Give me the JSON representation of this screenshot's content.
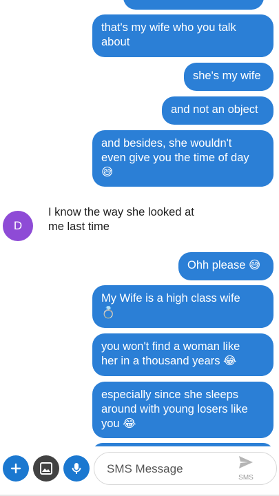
{
  "messages": {
    "m1": "that's my wife who you talk\nabout",
    "m2": "she's my wife",
    "m3": "and not an object",
    "m4": "and besides, she wouldn't\neven give you the time of day\n😅",
    "incoming": "I know the way she looked at\nme last time",
    "m5": "Ohh please 😅",
    "m6": "My Wife is a high class wife\n💍",
    "m7": "you won't find a woman like\nher in a thousand years 😂",
    "m8": "especially since she sleeps\naround with young losers like\nyou 😂"
  },
  "contact": {
    "avatar_letter": "D"
  },
  "composer": {
    "placeholder": "SMS Message",
    "send_mode": "SMS"
  },
  "colors": {
    "outgoing_bubble": "#2b7fd6",
    "avatar": "#8e4bd6",
    "action_buttons": "#1b78d0",
    "gallery_button": "#424242"
  }
}
